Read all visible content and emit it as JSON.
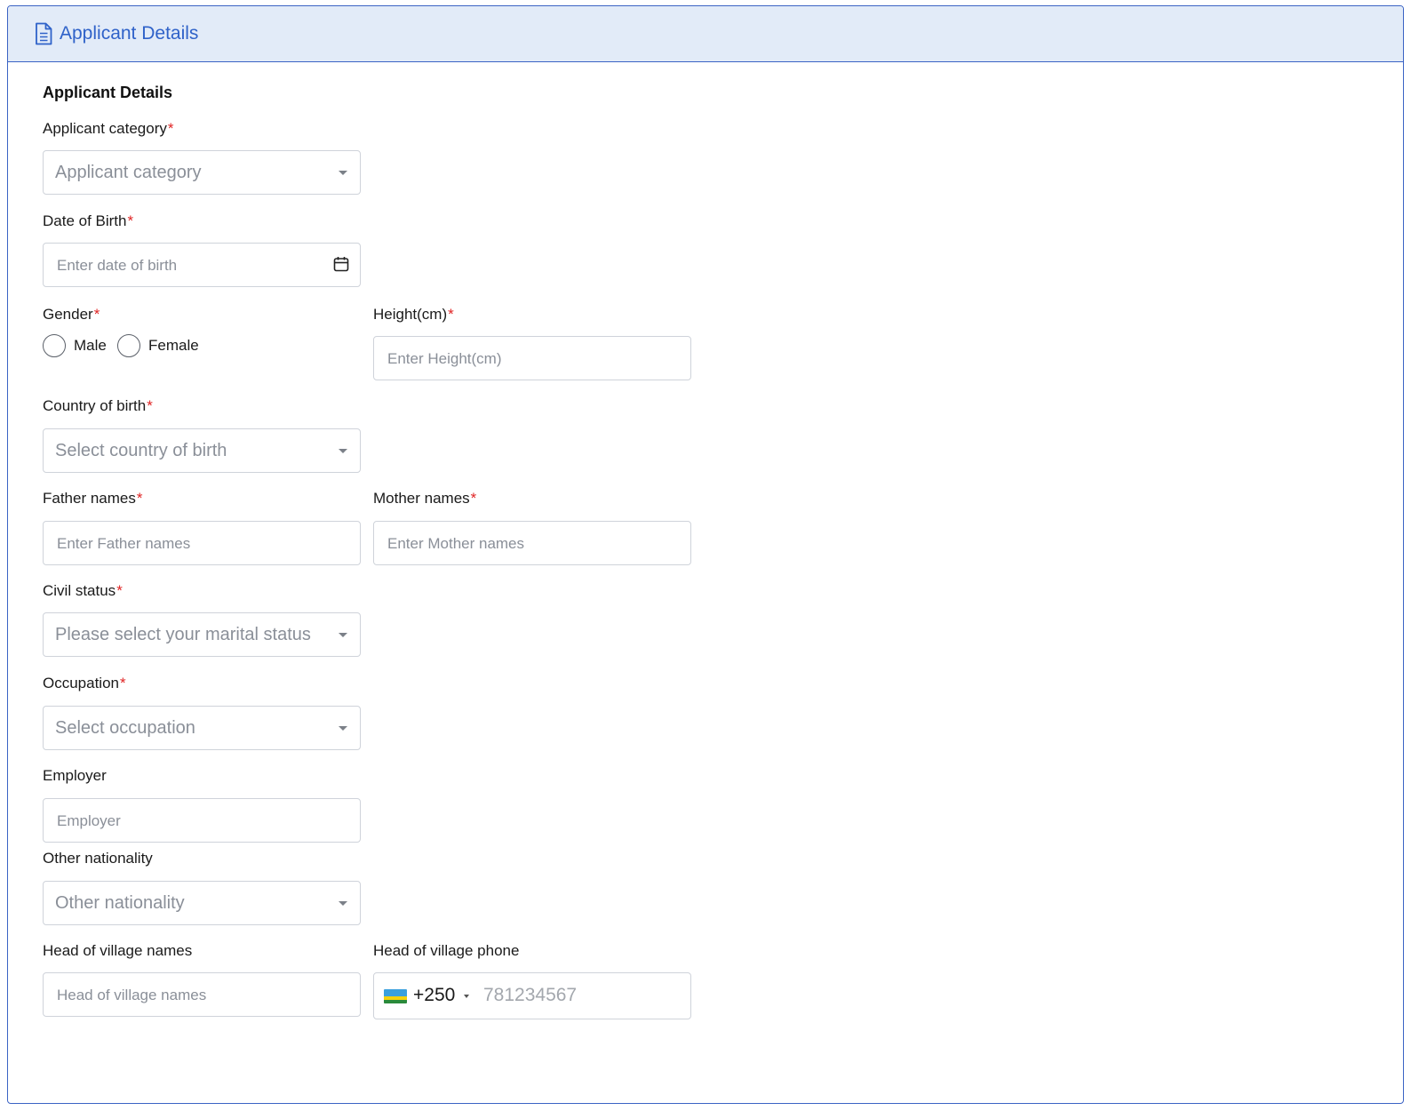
{
  "header": {
    "title": "Applicant Details",
    "icon": "document-icon"
  },
  "section": {
    "title": "Applicant Details"
  },
  "required_marker": "*",
  "fields": {
    "applicant_category": {
      "label": "Applicant category",
      "placeholder": "Applicant category",
      "required": true
    },
    "date_of_birth": {
      "label": "Date of Birth",
      "placeholder": "Enter date of birth",
      "required": true,
      "icon": "calendar-icon"
    },
    "gender": {
      "label": "Gender",
      "required": true,
      "options": [
        "Male",
        "Female"
      ]
    },
    "height": {
      "label": "Height(cm)",
      "placeholder": "Enter Height(cm)",
      "required": true
    },
    "country_of_birth": {
      "label": "Country of birth",
      "placeholder": "Select country of birth",
      "required": true
    },
    "father_names": {
      "label": "Father names",
      "placeholder": "Enter Father names",
      "required": true
    },
    "mother_names": {
      "label": "Mother names",
      "placeholder": "Enter Mother names",
      "required": true
    },
    "civil_status": {
      "label": "Civil status",
      "placeholder": "Please select your marital status",
      "required": true
    },
    "occupation": {
      "label": "Occupation",
      "placeholder": "Select occupation",
      "required": true
    },
    "employer": {
      "label": "Employer",
      "placeholder": "Employer"
    },
    "other_nationality": {
      "label": "Other nationality",
      "placeholder": "Other nationality"
    },
    "head_of_village_names": {
      "label": "Head of village names",
      "placeholder": "Head of village names"
    },
    "head_of_village_phone": {
      "label": "Head of village phone",
      "country_code": "+250",
      "placeholder": "781234567",
      "flag_icon": "rwanda-flag-icon"
    }
  },
  "colors": {
    "accent": "#2f62c9",
    "header_bg": "#e2ebf8",
    "border": "#3b63c4",
    "required": "#e02424"
  }
}
